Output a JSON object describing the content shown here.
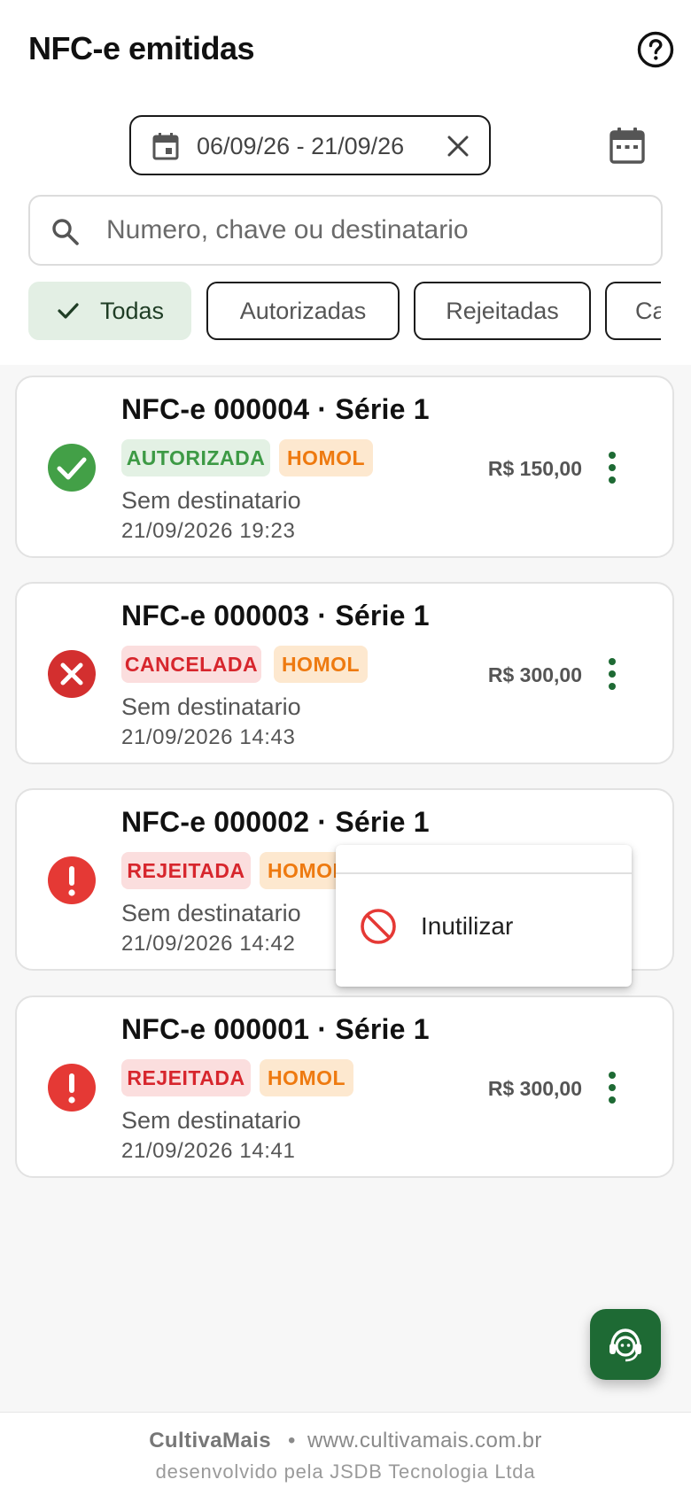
{
  "header": {
    "title": "NFC-e emitidas",
    "help_icon": "help-circle-icon"
  },
  "filters": {
    "date_range": "06/09/26 - 21/09/26",
    "search_placeholder": "Numero, chave ou destinatario",
    "search_value": "",
    "chips": [
      "Todas",
      "Autorizadas",
      "Rejeitadas",
      "Canceladas"
    ],
    "selected_chip": "Todas"
  },
  "cards": [
    {
      "title": "NFC-e 000004 · Série 1",
      "status": "AUTORIZADA",
      "env": "HOMOL",
      "dest": "Sem destinatario",
      "date": "21/09/2026 19:23",
      "amount": "R$ 150,00",
      "icon": "check-circle-icon",
      "color": "#43a047"
    },
    {
      "title": "NFC-e 000003 · Série 1",
      "status": "CANCELADA",
      "env": "HOMOL",
      "dest": "Sem destinatario",
      "date": "21/09/2026 14:43",
      "amount": "R$ 300,00",
      "icon": "x-circle-icon",
      "color": "#d32f2f"
    },
    {
      "title": "NFC-e 000002 · Série 1",
      "status": "REJEITADA",
      "env": "HOMOL",
      "dest": "Sem destinatario",
      "date": "21/09/2026 14:42",
      "amount": "",
      "icon": "alert-circle-icon",
      "color": "#e53935"
    },
    {
      "title": "NFC-e 000001 · Série 1",
      "status": "REJEITADA",
      "env": "HOMOL",
      "dest": "Sem destinatario",
      "date": "21/09/2026 14:41",
      "amount": "R$ 300,00",
      "icon": "alert-circle-icon",
      "color": "#e53935"
    }
  ],
  "context_menu": {
    "item_label": "Inutilizar",
    "item_icon": "ban-icon"
  },
  "fab": {
    "icon": "support-agent-icon"
  },
  "footer": {
    "brand": "CultivaMais",
    "separator": "•",
    "site": "www.cultivamais.com.br",
    "credit": "desenvolvido pela JSDB Tecnologia Ltda"
  },
  "colors": {
    "accent": "#1e6a34",
    "success": "#43a047",
    "danger": "#d32f2f",
    "warning": "#ee7a10"
  }
}
